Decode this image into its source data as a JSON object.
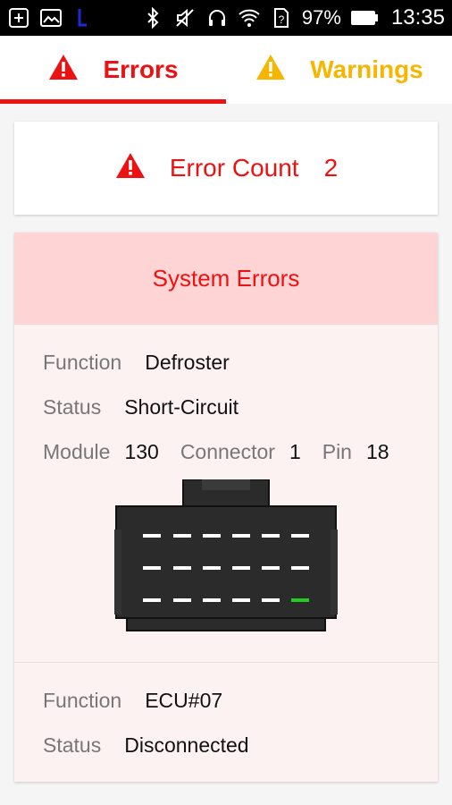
{
  "status_bar": {
    "icons_left": [
      "add-box-icon",
      "image-icon",
      "launcher-icon"
    ],
    "icons_right": [
      "bluetooth-icon",
      "mute-icon",
      "headset-icon",
      "wifi-icon",
      "sim-unknown-icon",
      "battery-icon"
    ],
    "battery": "97%",
    "time": "13:35"
  },
  "tabs": [
    {
      "label": "Errors",
      "icon": "error-triangle-icon",
      "color": "#ee1111",
      "selected": true
    },
    {
      "label": "Warnings",
      "icon": "warning-triangle-icon",
      "color": "#f7b500",
      "selected": false
    }
  ],
  "error_count": {
    "label": "Error Count",
    "value": "2"
  },
  "system_errors": {
    "title": "System Errors",
    "errors": [
      {
        "function_label": "Function",
        "function_value": "Defroster",
        "status_label": "Status",
        "status_value": "Short-Circuit",
        "module_label": "Module",
        "module_value": "130",
        "connector_label": "Connector",
        "connector_value": "1",
        "pin_label": "Pin",
        "pin_value": "18"
      },
      {
        "function_label": "Function",
        "function_value": "ECU#07",
        "status_label": "Status",
        "status_value": "Disconnected"
      }
    ]
  },
  "colors": {
    "accent": "#ee1111",
    "warning": "#f7b500",
    "pin_highlight": "#22cc22"
  }
}
